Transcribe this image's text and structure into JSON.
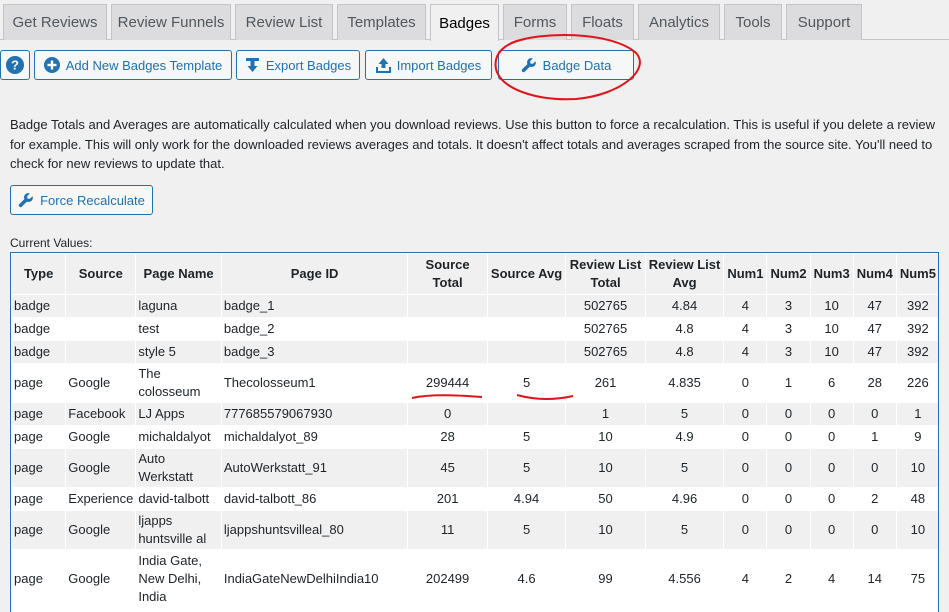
{
  "tabs": [
    {
      "label": "Get Reviews"
    },
    {
      "label": "Review Funnels"
    },
    {
      "label": "Review List"
    },
    {
      "label": "Templates"
    },
    {
      "label": "Badges"
    },
    {
      "label": "Forms"
    },
    {
      "label": "Floats"
    },
    {
      "label": "Analytics"
    },
    {
      "label": "Tools"
    },
    {
      "label": "Support"
    }
  ],
  "active_tab": "Badges",
  "toolbar": {
    "add_template": "Add New Badges Template",
    "export": "Export Badges",
    "import": "Import Badges",
    "badge_data": "Badge Data"
  },
  "description": "Badge Totals and Averages are automatically calculated when you download reviews. Use this button to force a recalculation. This is useful if you delete a review for example. This will only work for the downloaded reviews averages and totals. It doesn't affect totals and averages scraped from the source site. You'll need to check for new reviews to update that.",
  "force_button": "Force Recalculate",
  "current_values_label": "Current Values:",
  "table": {
    "headers": [
      "Type",
      "Source",
      "Page Name",
      "Page ID",
      "Source Total",
      "Source Avg",
      "Review List Total",
      "Review List Avg",
      "Num1",
      "Num2",
      "Num3",
      "Num4",
      "Num5"
    ],
    "rows": [
      [
        "badge",
        "",
        "laguna",
        "badge_1",
        "",
        "",
        "502765",
        "4.84",
        "4",
        "3",
        "10",
        "47",
        "392"
      ],
      [
        "badge",
        "",
        "test",
        "badge_2",
        "",
        "",
        "502765",
        "4.8",
        "4",
        "3",
        "10",
        "47",
        "392"
      ],
      [
        "badge",
        "",
        "style 5",
        "badge_3",
        "",
        "",
        "502765",
        "4.8",
        "4",
        "3",
        "10",
        "47",
        "392"
      ],
      [
        "page",
        "Google",
        "The colosseum",
        "Thecolosseum1",
        "299444",
        "5",
        "261",
        "4.835",
        "0",
        "1",
        "6",
        "28",
        "226"
      ],
      [
        "page",
        "Facebook",
        "LJ Apps",
        "777685579067930",
        "0",
        "",
        "1",
        "5",
        "0",
        "0",
        "0",
        "0",
        "1"
      ],
      [
        "page",
        "Google",
        "michaldalyot",
        "michaldalyot_89",
        "28",
        "5",
        "10",
        "4.9",
        "0",
        "0",
        "0",
        "1",
        "9"
      ],
      [
        "page",
        "Google",
        "Auto Werkstatt",
        "AutoWerkstatt_91",
        "45",
        "5",
        "10",
        "5",
        "0",
        "0",
        "0",
        "0",
        "10"
      ],
      [
        "page",
        "Experience",
        "david-talbott",
        "david-talbott_86",
        "201",
        "4.94",
        "50",
        "4.96",
        "0",
        "0",
        "0",
        "2",
        "48"
      ],
      [
        "page",
        "Google",
        "ljapps huntsville al",
        "ljappshuntsvilleal_80",
        "11",
        "5",
        "10",
        "5",
        "0",
        "0",
        "0",
        "0",
        "10"
      ],
      [
        "page",
        "Google",
        "India Gate, New Delhi, India",
        "IndiaGateNewDelhiIndia10",
        "202499",
        "4.6",
        "99",
        "4.556",
        "4",
        "2",
        "4",
        "14",
        "75"
      ]
    ]
  },
  "colors": {
    "accent": "#2271b1",
    "annotation": "#e0141c",
    "background": "#f0f0f1"
  }
}
